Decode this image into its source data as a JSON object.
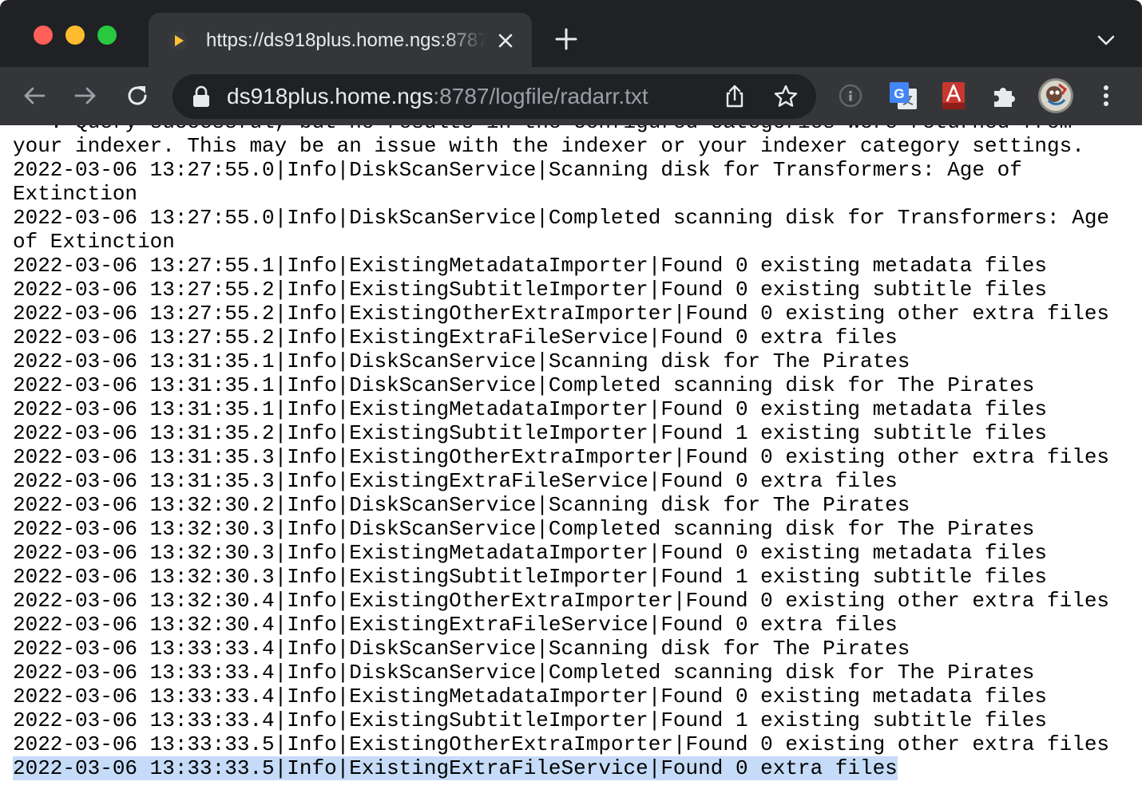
{
  "window": {
    "tab_title": "https://ds918plus.home.ngs:8787/logfile/radarr.txt",
    "colors": {
      "close": "#fe5f57",
      "minimize": "#febc2e",
      "maximize": "#28c840",
      "chrome_bg": "#202124",
      "toolbar_bg": "#35363a",
      "selection": "#c5dbf7"
    }
  },
  "omnibox": {
    "host": "ds918plus.home.ngs",
    "rest": ":8787/logfile/radarr.txt"
  },
  "icons": {
    "favicon": "play-triangle-icon",
    "tab_close": "close-icon",
    "new_tab": "plus-icon",
    "tab_search": "chevron-down-icon",
    "back": "arrow-left-icon",
    "forward": "arrow-right-icon",
    "reload": "reload-icon",
    "lock": "lock-icon",
    "share": "share-icon",
    "bookmark": "star-icon",
    "extensions": "puzzle-icon",
    "menu": "kebab-menu-icon"
  },
  "log": {
    "lines": [
      "   . Query successful, but no results in the configured categories were returned from",
      "your indexer. This may be an issue with the indexer or your indexer category settings.",
      "2022-03-06 13:27:55.0|Info|DiskScanService|Scanning disk for Transformers: Age of",
      "Extinction",
      "2022-03-06 13:27:55.0|Info|DiskScanService|Completed scanning disk for Transformers: Age",
      "of Extinction",
      "2022-03-06 13:27:55.1|Info|ExistingMetadataImporter|Found 0 existing metadata files",
      "2022-03-06 13:27:55.2|Info|ExistingSubtitleImporter|Found 0 existing subtitle files",
      "2022-03-06 13:27:55.2|Info|ExistingOtherExtraImporter|Found 0 existing other extra files",
      "2022-03-06 13:27:55.2|Info|ExistingExtraFileService|Found 0 extra files",
      "2022-03-06 13:31:35.1|Info|DiskScanService|Scanning disk for The Pirates",
      "2022-03-06 13:31:35.1|Info|DiskScanService|Completed scanning disk for The Pirates",
      "2022-03-06 13:31:35.1|Info|ExistingMetadataImporter|Found 0 existing metadata files",
      "2022-03-06 13:31:35.2|Info|ExistingSubtitleImporter|Found 1 existing subtitle files",
      "2022-03-06 13:31:35.3|Info|ExistingOtherExtraImporter|Found 0 existing other extra files",
      "2022-03-06 13:31:35.3|Info|ExistingExtraFileService|Found 0 extra files",
      "2022-03-06 13:32:30.2|Info|DiskScanService|Scanning disk for The Pirates",
      "2022-03-06 13:32:30.3|Info|DiskScanService|Completed scanning disk for The Pirates",
      "2022-03-06 13:32:30.3|Info|ExistingMetadataImporter|Found 0 existing metadata files",
      "2022-03-06 13:32:30.3|Info|ExistingSubtitleImporter|Found 1 existing subtitle files",
      "2022-03-06 13:32:30.4|Info|ExistingOtherExtraImporter|Found 0 existing other extra files",
      "2022-03-06 13:32:30.4|Info|ExistingExtraFileService|Found 0 extra files",
      "2022-03-06 13:33:33.4|Info|DiskScanService|Scanning disk for The Pirates",
      "2022-03-06 13:33:33.4|Info|DiskScanService|Completed scanning disk for The Pirates",
      "2022-03-06 13:33:33.4|Info|ExistingMetadataImporter|Found 0 existing metadata files",
      "2022-03-06 13:33:33.4|Info|ExistingSubtitleImporter|Found 1 existing subtitle files",
      "2022-03-06 13:33:33.5|Info|ExistingOtherExtraImporter|Found 0 existing other extra files",
      "2022-03-06 13:33:33.5|Info|ExistingExtraFileService|Found 0 extra files"
    ],
    "selected_line": "2022-03-06 13:33:33.5|Info|ExistingExtraFileService|Found 0 extra files"
  }
}
